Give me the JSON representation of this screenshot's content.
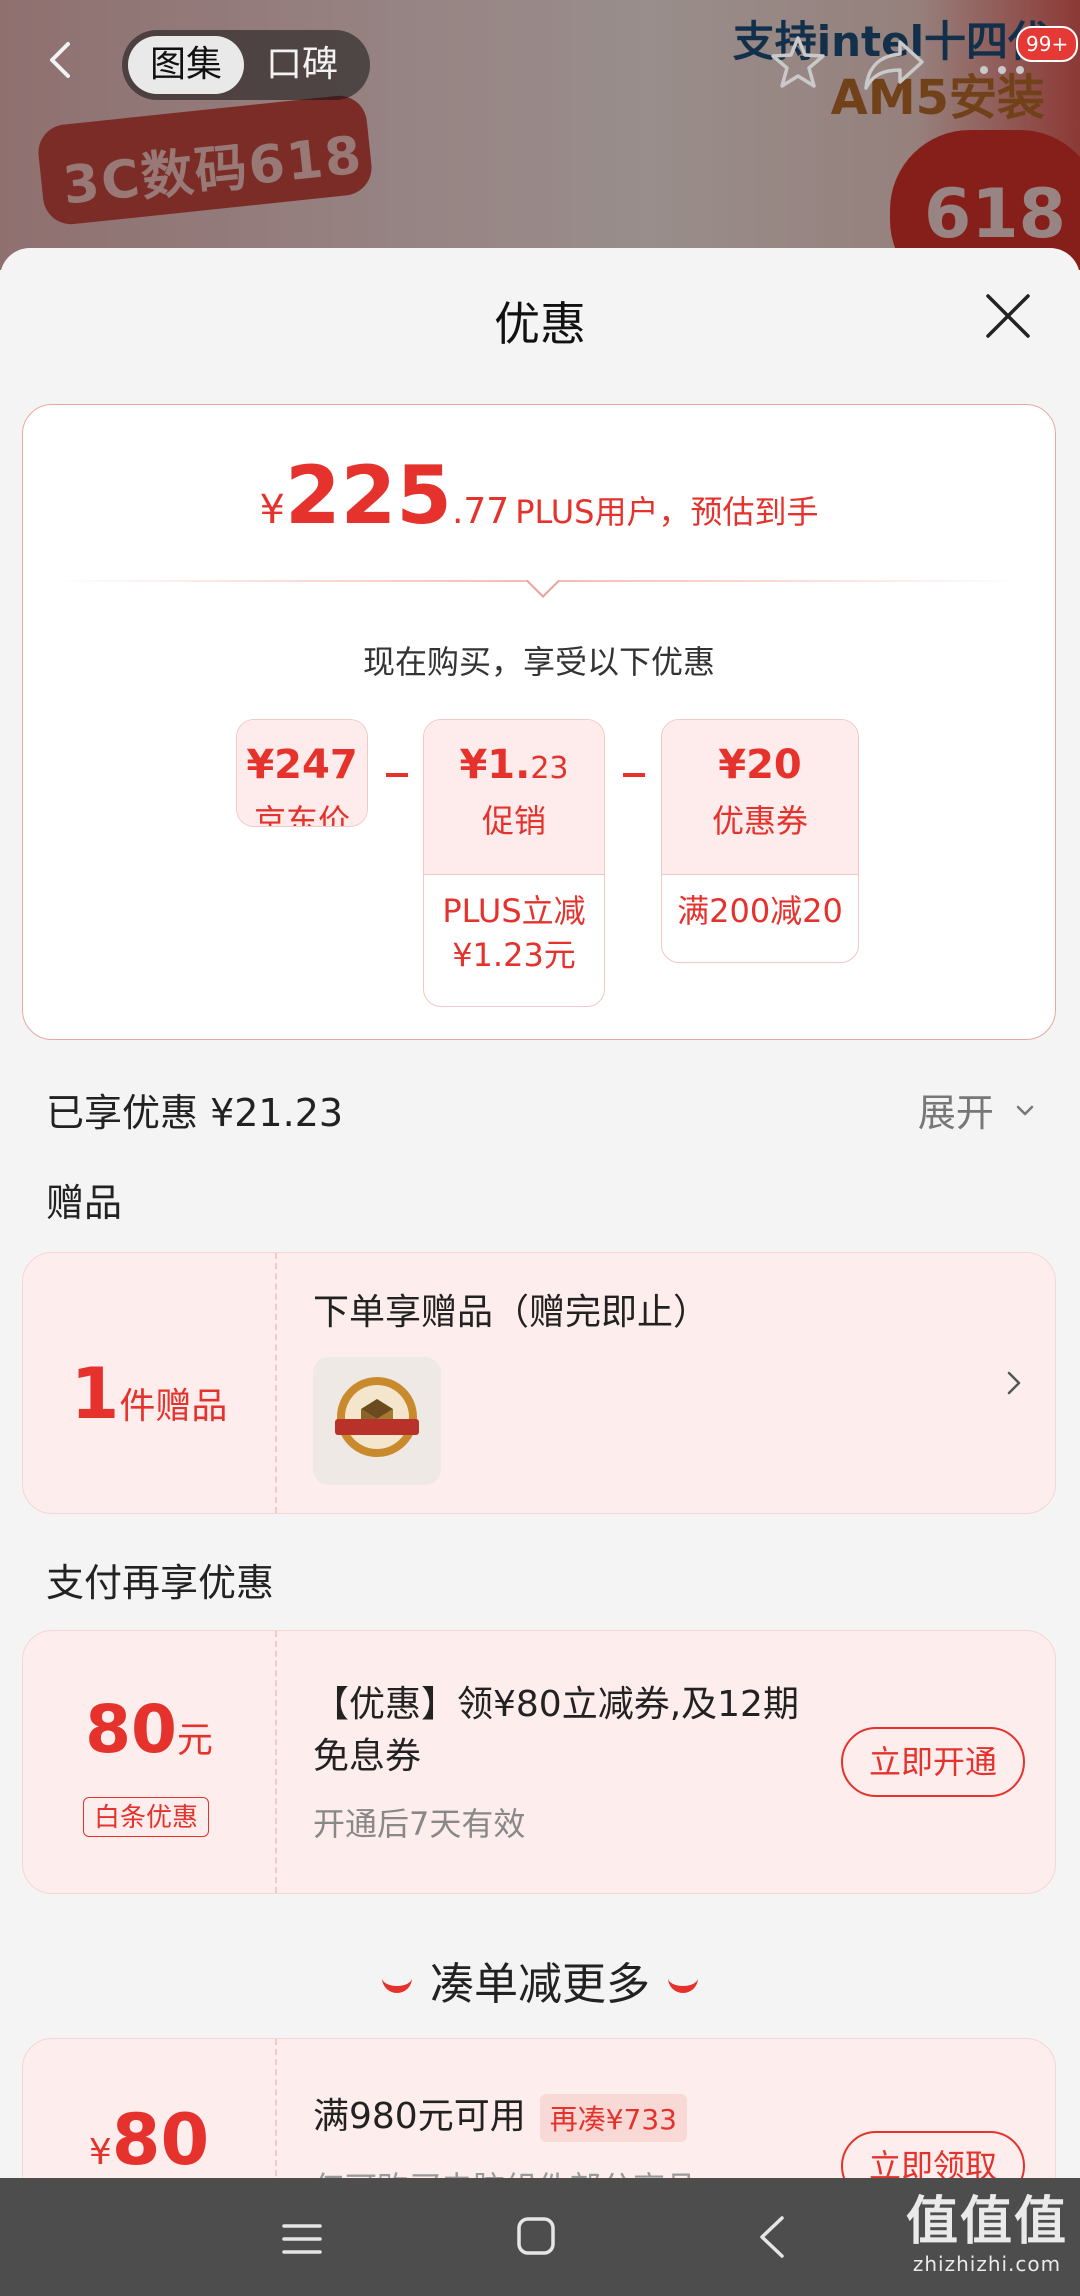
{
  "header": {
    "tabs": [
      "图集",
      "口碑"
    ],
    "active_tab": "图集",
    "notification_count": "99+",
    "banner": {
      "ribbon_text": "3C数码618",
      "promo_line1": "支持intel十四代",
      "promo_line2": "AM5安装",
      "badge": "618"
    }
  },
  "sheet": {
    "title": "优惠",
    "price": {
      "currency": "¥",
      "integer": "225",
      "decimal": ".77",
      "note": "PLUS用户，预估到手"
    },
    "breakdown_hint": "现在购买，享受以下优惠",
    "breakdown": [
      {
        "amount_main": "¥247",
        "amount_small": "",
        "label": "京东价",
        "detail": ""
      },
      {
        "amount_main": "¥1.",
        "amount_small": "23",
        "label": "促销",
        "detail_line1": "PLUS立减",
        "detail_line2": "¥1.23元"
      },
      {
        "amount_main": "¥20",
        "amount_small": "",
        "label": "优惠券",
        "detail_line1": "满200减20",
        "detail_line2": ""
      }
    ],
    "enjoyed_text": "已享优惠 ¥21.23",
    "expand_label": "展开",
    "gifts": {
      "section_title": "赠品",
      "count": "1",
      "count_unit": "件赠品",
      "title": "下单享赠品（赠完即止）"
    },
    "payment": {
      "section_title": "支付再享优惠",
      "amount": "80",
      "unit": "元",
      "tag": "白条优惠",
      "title": "【优惠】领¥80立减券,及12期免息券",
      "subtitle": "开通后7天有效",
      "button": "立即开通"
    },
    "more_heading": "凑单减更多",
    "coupon": {
      "currency": "¥",
      "amount": "80",
      "title": "满980元可用",
      "extra_tag": "再凑¥733",
      "subtitle": "仅可购买电脑组件部分商品",
      "button": "立即领取"
    }
  },
  "watermark": {
    "big": "值值值",
    "small": "zhizhizhi.com"
  },
  "colors": {
    "accent": "#e5322c",
    "panel_bg": "#fdeeed",
    "page_bg": "#f4f4f4",
    "navbar": "#4d4d4d"
  }
}
